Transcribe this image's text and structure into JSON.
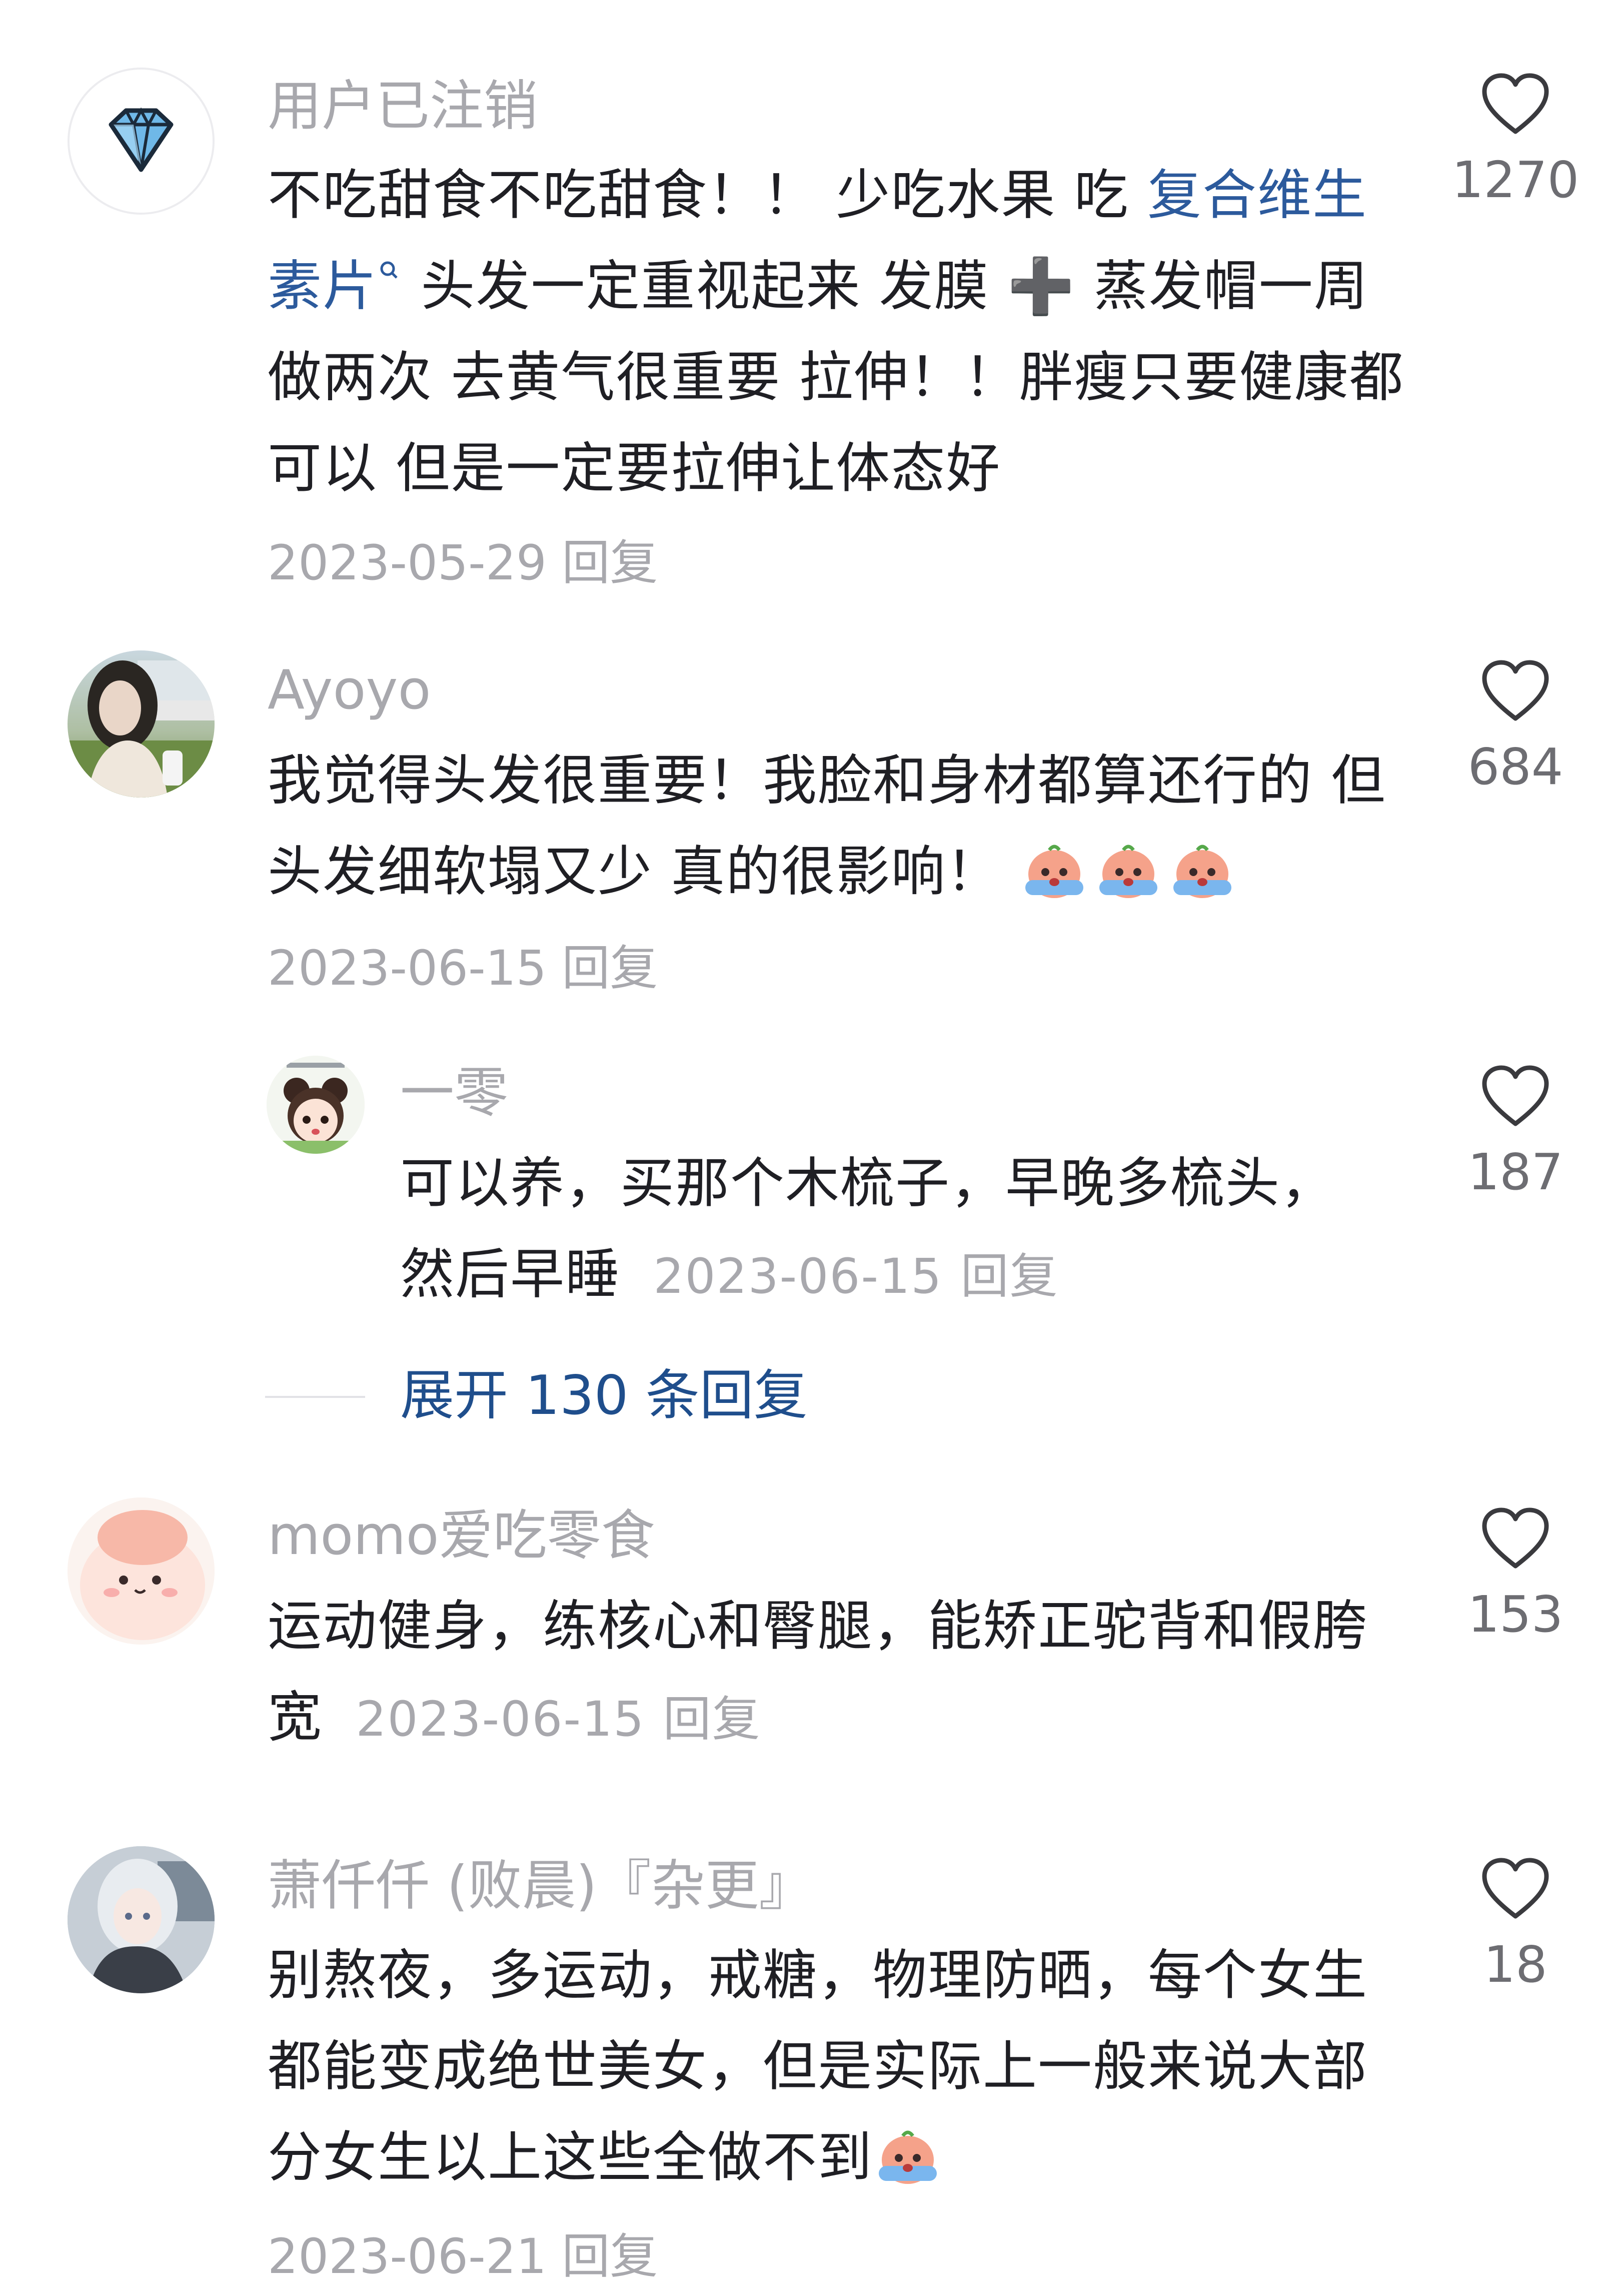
{
  "comments": [
    {
      "username": "用户已注销",
      "avatar_icon": "diamond-icon",
      "text_before_link": "不吃甜食不吃甜食！！  少吃水果 吃 ",
      "link_text": "复合维生素片",
      "link_icon": "search-icon",
      "text_after_link": " 头发一定重视起来 发膜 ➕ 蒸发帽一周做两次  去黄气很重要  拉伸！！胖瘦只要健康都可以 但是一定要拉伸让体态好",
      "date": "2023-05-29",
      "reply_label": "回复",
      "like_count": "1270"
    },
    {
      "username": "Ayoyo",
      "avatar_icon": "user-photo-avatar",
      "text": "我觉得头发很重要！我脸和身材都算还行的 但头发细软塌又少 真的很影响！",
      "emoji": "crying-emoji",
      "date": "2023-06-15",
      "reply_label": "回复",
      "like_count": "684"
    },
    {
      "username": "momo爱吃零食",
      "avatar_icon": "cartoon-peach-avatar",
      "text": "运动健身，练核心和臀腿，能矫正驼背和假胯宽",
      "date": "2023-06-15",
      "reply_label": "回复",
      "like_count": "153"
    },
    {
      "username": "萧仟仟 (败晨)『杂更』",
      "avatar_icon": "anime-girl-avatar",
      "text": "别熬夜，多运动，戒糖，物理防晒，每个女生都能变成绝世美女，但是实际上一般来说大部分女生以上这些全做不到",
      "emoji": "crying-emoji",
      "date": "2023-06-21",
      "reply_label": "回复",
      "like_count": "18"
    }
  ],
  "reply": {
    "username": "一零",
    "avatar_icon": "cartoon-girl-avatar",
    "text": "可以养，买那个木梳子，早晚多梳头，然后早睡",
    "date": "2023-06-15",
    "reply_label": "回复",
    "like_count": "187"
  },
  "expand_replies": "展开 130 条回复",
  "colors": {
    "username": "#a8a8ad",
    "body_text": "#1f1f24",
    "link": "#2c5a9c",
    "expand": "#1f4e8c"
  }
}
